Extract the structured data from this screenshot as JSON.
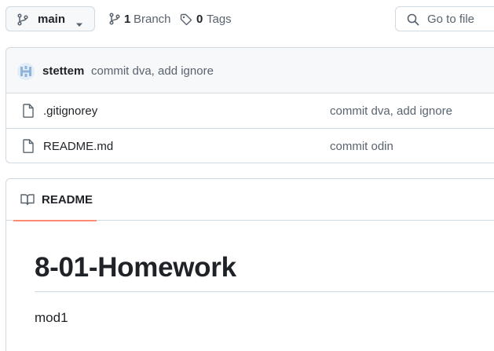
{
  "toolbar": {
    "branch_name": "main",
    "branch_count": "1",
    "branch_label": "Branch",
    "tag_count": "0",
    "tag_label": "Tags",
    "go_to_file_placeholder": "Go to file"
  },
  "latest_commit": {
    "author": "stettem",
    "message": "commit dva, add ignore"
  },
  "files": [
    {
      "name": ".gitignorey",
      "commit_message": "commit dva, add ignore",
      "icon": "file-icon"
    },
    {
      "name": "README.md",
      "commit_message": "commit odin",
      "icon": "file-icon"
    }
  ],
  "readme": {
    "tab_label": "README",
    "heading": "8-01-Homework",
    "body": "mod1"
  },
  "colors": {
    "accent_underline": "#fd8c73",
    "border": "#d1d9e0",
    "muted_text": "#59636e"
  }
}
